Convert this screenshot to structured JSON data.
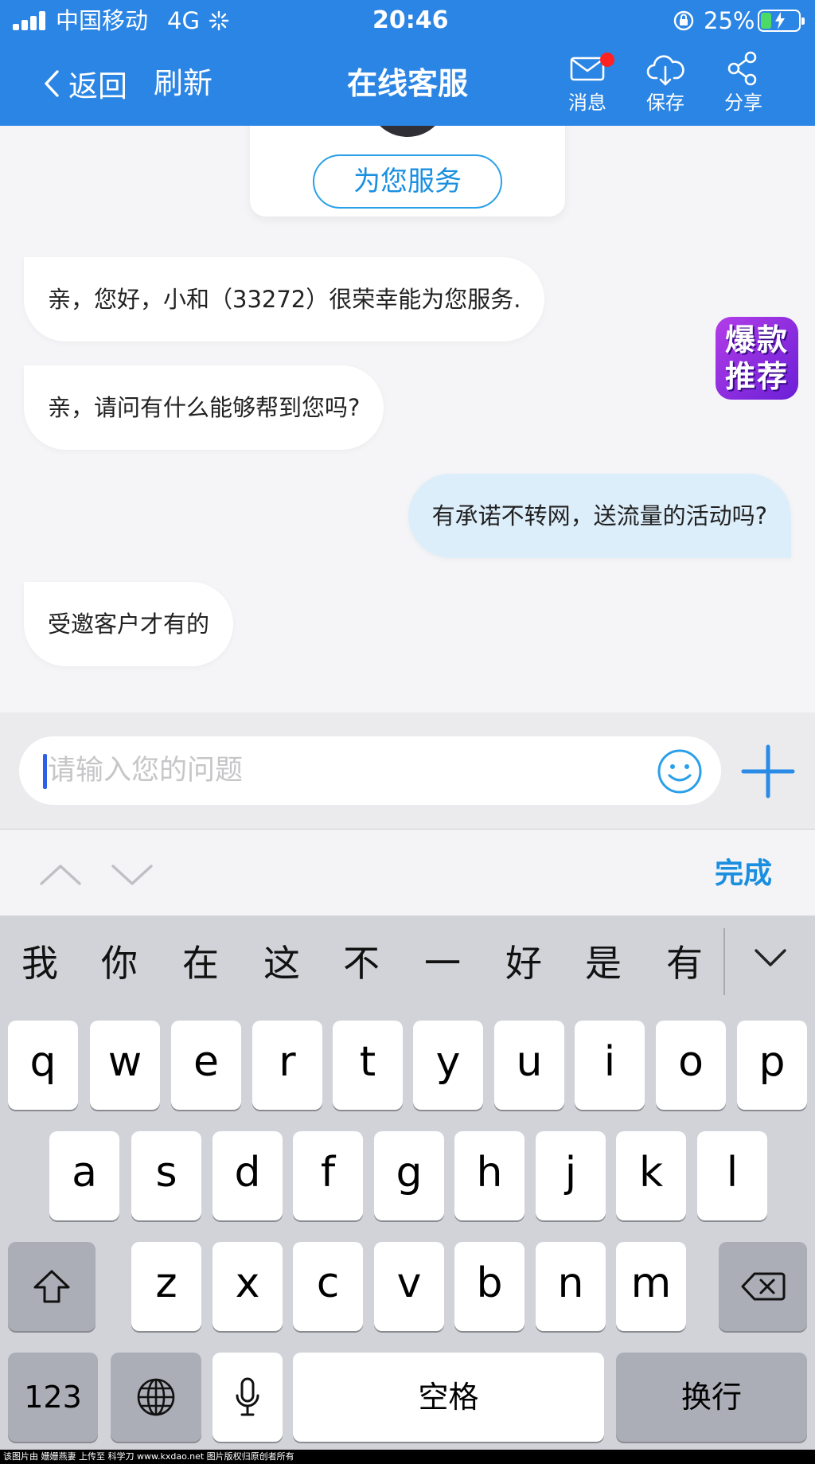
{
  "status_bar": {
    "carrier": "中国移动",
    "network": "4G",
    "time": "20:46",
    "battery": "25%"
  },
  "header": {
    "back_label": "返回",
    "refresh_label": "刷新",
    "title": "在线客服",
    "actions": [
      {
        "label": "消息",
        "icon": "mail-icon",
        "has_badge": true
      },
      {
        "label": "保存",
        "icon": "cloud-download-icon"
      },
      {
        "label": "分享",
        "icon": "share-icon"
      }
    ],
    "colors": {
      "bar": "#2b85e4",
      "badge": "#ff2222"
    }
  },
  "chat": {
    "service_button": "为您服务",
    "promo_badge": [
      "爆款",
      "推荐"
    ],
    "messages": [
      {
        "from": "agent",
        "text": "亲，您好，小和（33272）很荣幸能为您服务."
      },
      {
        "from": "agent",
        "text": "亲，请问有什么能够帮到您吗?"
      },
      {
        "from": "user",
        "text": "有承诺不转网，送流量的活动吗?"
      },
      {
        "from": "agent",
        "text": "受邀客户才有的"
      }
    ]
  },
  "input": {
    "placeholder": "请输入您的问题",
    "value": ""
  },
  "toolbar": {
    "done_label": "完成"
  },
  "keyboard": {
    "candidates": [
      "我",
      "你",
      "在",
      "这",
      "不",
      "一",
      "好",
      "是",
      "有"
    ],
    "row1": [
      "q",
      "w",
      "e",
      "r",
      "t",
      "y",
      "u",
      "i",
      "o",
      "p"
    ],
    "row2": [
      "a",
      "s",
      "d",
      "f",
      "g",
      "h",
      "j",
      "k",
      "l"
    ],
    "row3": [
      "z",
      "x",
      "c",
      "v",
      "b",
      "n",
      "m"
    ],
    "numbers_label": "123",
    "space_label": "空格",
    "return_label": "换行"
  },
  "footer": "该图片由 姗姗燕妻 上传至 科学刀 www.kxdao.net 图片版权归原创者所有"
}
